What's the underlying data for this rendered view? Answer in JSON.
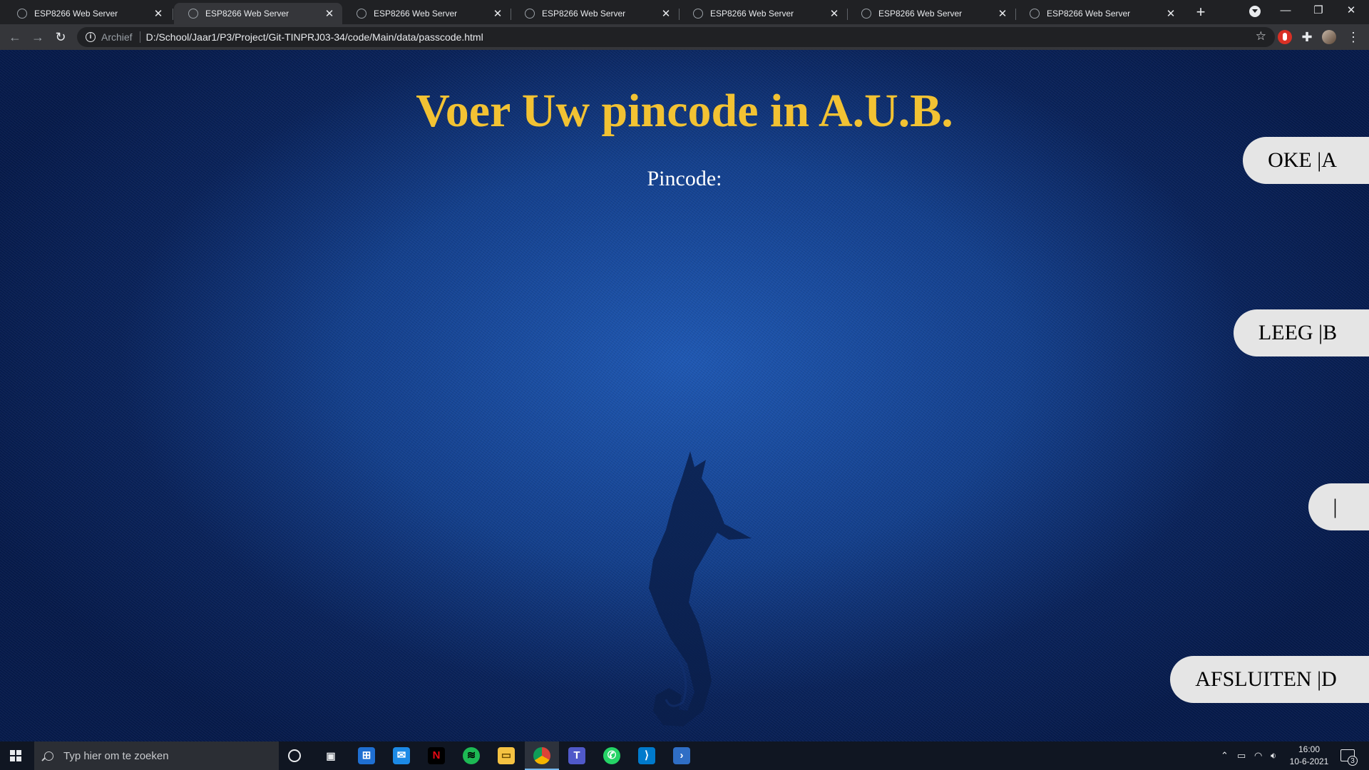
{
  "browser": {
    "tabs": [
      {
        "title": "ESP8266 Web Server",
        "active": false
      },
      {
        "title": "ESP8266 Web Server",
        "active": true
      },
      {
        "title": "ESP8266 Web Server",
        "active": false
      },
      {
        "title": "ESP8266 Web Server",
        "active": false
      },
      {
        "title": "ESP8266 Web Server",
        "active": false
      },
      {
        "title": "ESP8266 Web Server",
        "active": false
      },
      {
        "title": "ESP8266 Web Server",
        "active": false
      }
    ],
    "new_tab": "+",
    "close_glyph": "✕",
    "window": {
      "minimize": "—",
      "restore": "❐",
      "close": "✕"
    },
    "address": {
      "chip": "Archief",
      "url": "D:/School/Jaar1/P3/Project/Git-TINPRJ03-34/code/Main/data/passcode.html"
    }
  },
  "page": {
    "title": "Voer Uw pincode in A.U.B.",
    "pin_label": "Pincode:",
    "buttons": {
      "ok": "OKE |A",
      "clear": "LEEG |B",
      "third": "|",
      "close": "AFSLUITEN |D"
    }
  },
  "taskbar": {
    "search_placeholder": "Typ hier om te zoeken",
    "time": "16:00",
    "date": "10-6-2021",
    "notification_count": "3"
  },
  "colors": {
    "title": "#f2c233",
    "button_bg": "#e5e5e5",
    "background": "#0d3c8f"
  }
}
